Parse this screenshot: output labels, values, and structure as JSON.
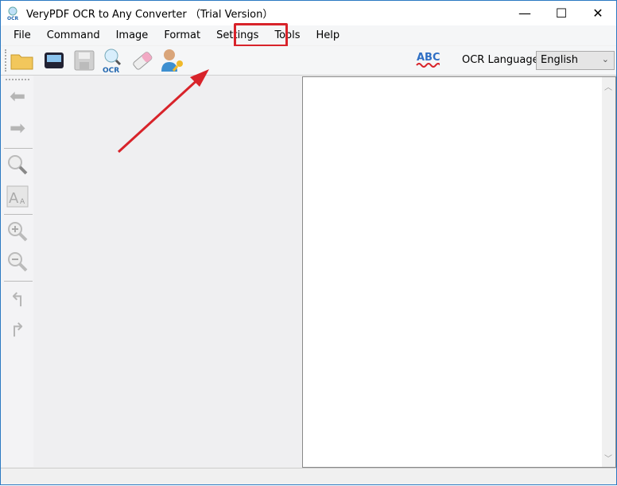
{
  "title": "VeryPDF OCR to Any Converter （Trial Version）",
  "window_controls": {
    "minimize": "—",
    "maximize": "☐",
    "close": "✕"
  },
  "menu": [
    "File",
    "Command",
    "Image",
    "Format",
    "Settings",
    "Tools",
    "Help"
  ],
  "toolbar": {
    "ocr_language_label": "OCR Language",
    "ocr_language_value": "English",
    "spell_icon_text": "ABC",
    "ocr_icon_text": "OCR"
  },
  "colors": {
    "highlight": "#d8232a",
    "accent": "#2b79c2"
  }
}
